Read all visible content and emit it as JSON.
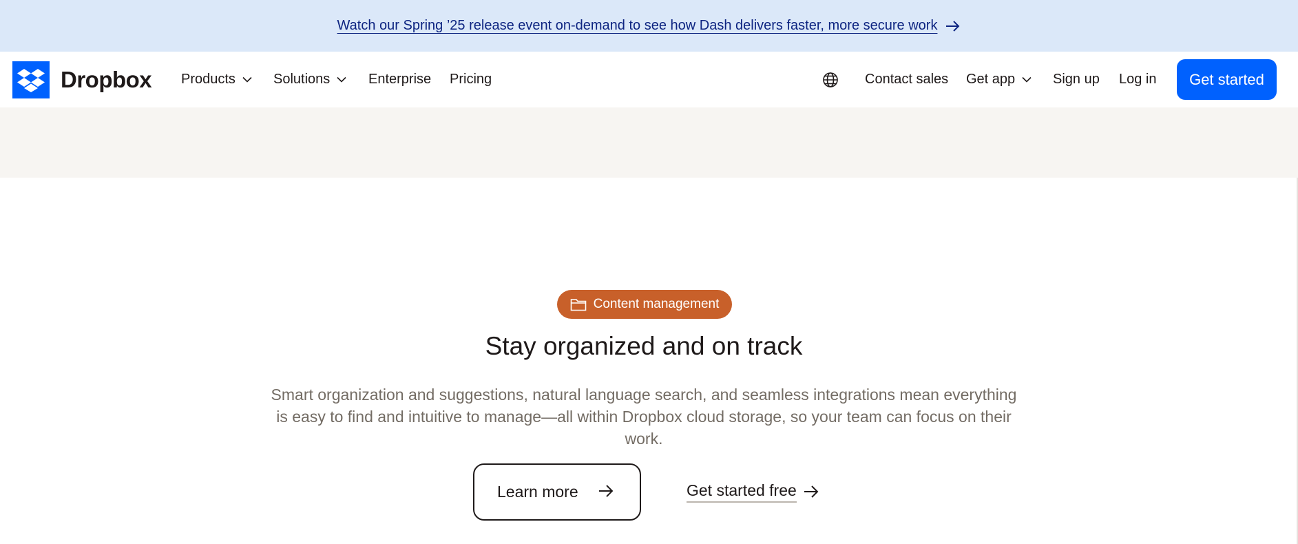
{
  "banner": {
    "text": "Watch our Spring ’25 release event on-demand to see how Dash delivers faster, more secure work",
    "icon": "arrow-right-icon"
  },
  "nav": {
    "logo_text": "Dropbox",
    "items": [
      {
        "label": "Products",
        "has_dropdown": true
      },
      {
        "label": "Solutions",
        "has_dropdown": true
      },
      {
        "label": "Enterprise",
        "has_dropdown": false
      },
      {
        "label": "Pricing",
        "has_dropdown": false
      }
    ],
    "right": {
      "language_icon": "globe-icon",
      "contact_sales": "Contact sales",
      "get_app": "Get app",
      "sign_up": "Sign up",
      "log_in": "Log in",
      "get_started": "Get started"
    }
  },
  "hero": {
    "pill_label": "Content management",
    "pill_icon": "folder-icon",
    "headline": "Stay organized and on track",
    "subtext": "Smart organization and suggestions, natural language search, and seamless integrations mean everything is easy to find and intuitive to manage—all within Dropbox cloud storage, so your team can focus on their work.",
    "learn_more": "Learn more",
    "get_started_free": "Get started free"
  },
  "colors": {
    "brand_blue": "#0061fe",
    "banner_bg": "#dbe8f9",
    "pill_bg": "#c8602a",
    "grey_band": "#f7f5f2",
    "text": "#1e1919",
    "muted_text": "#736c64"
  }
}
